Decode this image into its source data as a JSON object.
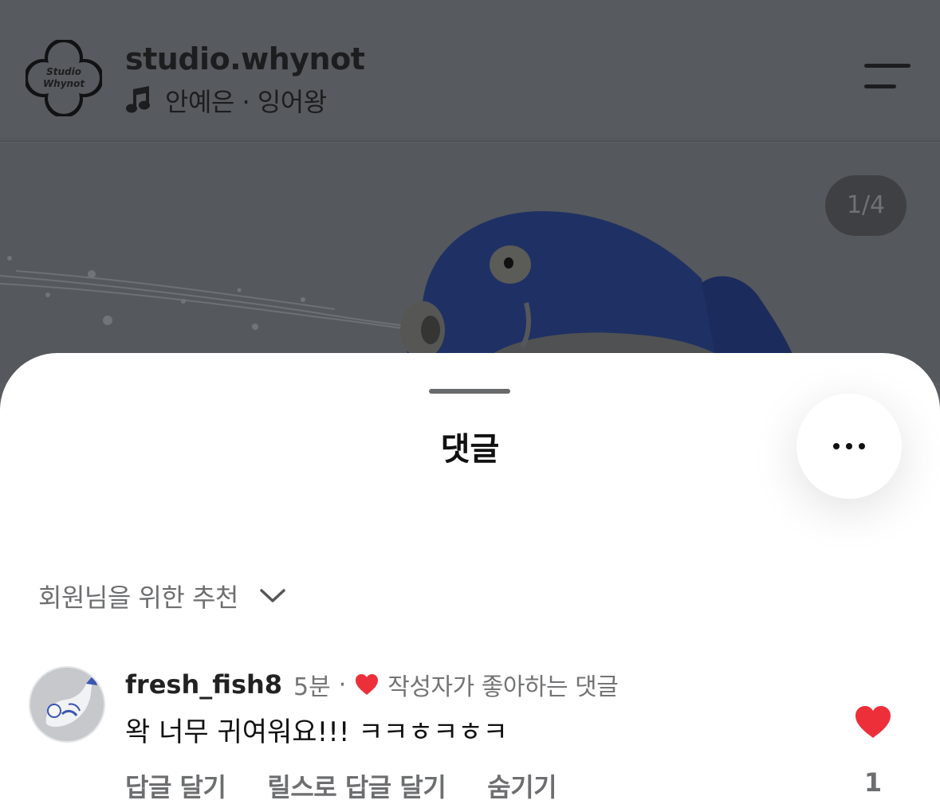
{
  "post": {
    "account": "studio.whynot",
    "avatar_logo": "Studio Whynot",
    "music": "안예은 · 잉어왕",
    "media_counter": "1/4",
    "icons": {
      "music": "music-note-icon",
      "menu": "hamburger-menu-icon"
    }
  },
  "sheet": {
    "title": "댓글",
    "sort_label": "회원님을 위한 추천",
    "icons": {
      "more": "more-options-icon",
      "sort": "chevron-down-icon"
    }
  },
  "comments": [
    {
      "username": "fresh_fish8",
      "time": "5분",
      "separator": "·",
      "author_liked": "작성자가 좋아하는 댓글",
      "text": "왁 너무 귀여워요!!! ㅋㅋㅎㅋㅎㅋ",
      "actions": [
        "답글 달기",
        "릴스로 답글 달기",
        "숨기기"
      ],
      "like_count": "1",
      "liked": true
    }
  ],
  "colors": {
    "heart": "#ed2f3a",
    "dim_overlay": "#595c60",
    "sheet": "#ffffff"
  }
}
